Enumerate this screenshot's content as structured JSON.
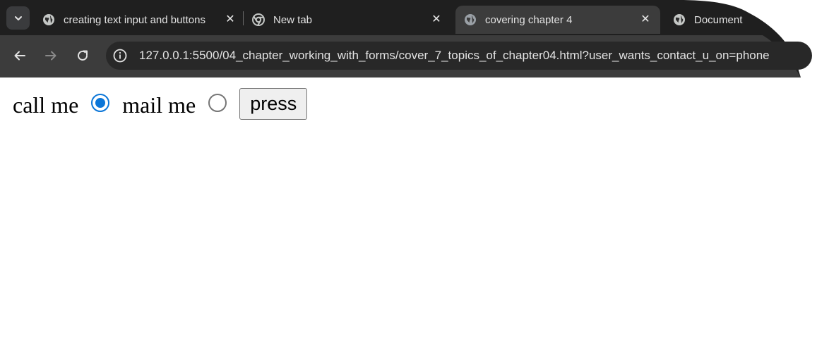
{
  "browser": {
    "tabs": [
      {
        "title": "creating text input and buttons",
        "icon": "globe-icon",
        "active": false
      },
      {
        "title": "New tab",
        "icon": "chrome-icon",
        "active": false
      },
      {
        "title": "covering chapter 4",
        "icon": "globe-icon",
        "active": true
      },
      {
        "title": "Document",
        "icon": "globe-icon",
        "active": false
      }
    ],
    "tab_close_glyph": "✕",
    "url": "127.0.0.1:5500/04_chapter_working_with_forms/cover_7_topics_of_chapter04.html?user_wants_contact_u_on=phone",
    "colors": {
      "chrome_dark": "#1f1f1f",
      "toolbar": "#3c3c3c",
      "omnibox": "#282828",
      "radio_accent": "#0b76d8"
    }
  },
  "page": {
    "option1_label": "call me",
    "option1_checked": true,
    "option2_label": "mail me",
    "option2_checked": false,
    "button_label": "press"
  }
}
